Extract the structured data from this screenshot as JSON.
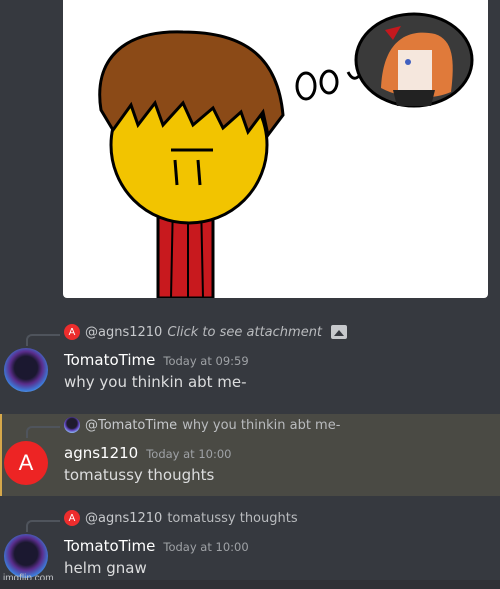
{
  "colors": {
    "background": "#36393f",
    "highlight": "#4a4a44",
    "highlight_bar": "#d6a84a",
    "avatar_red": "#ed2424"
  },
  "attachment": {
    "kind": "drawing",
    "description": "cartoon character with brown hair and yellow face, red shirt, thought bubble"
  },
  "messages": [
    {
      "reply": {
        "avatar": "A",
        "user": "@agns1210",
        "content": "Click to see attachment",
        "icon": "image-icon"
      },
      "author": "TomatoTime",
      "timestamp": "Today at 09:59",
      "text": "why you thinkin abt me-"
    },
    {
      "reply": {
        "user": "@TomatoTime",
        "content": "why you thinkin abt me-"
      },
      "author": "agns1210",
      "avatar_letter": "A",
      "timestamp": "Today at 10:00",
      "text": "tomatussy thoughts"
    },
    {
      "reply": {
        "avatar": "A",
        "user": "@agns1210",
        "content": "tomatussy thoughts"
      },
      "author": "TomatoTime",
      "timestamp": "Today at 10:00",
      "text": "helm gnaw"
    }
  ],
  "watermark": "imgflip.com"
}
